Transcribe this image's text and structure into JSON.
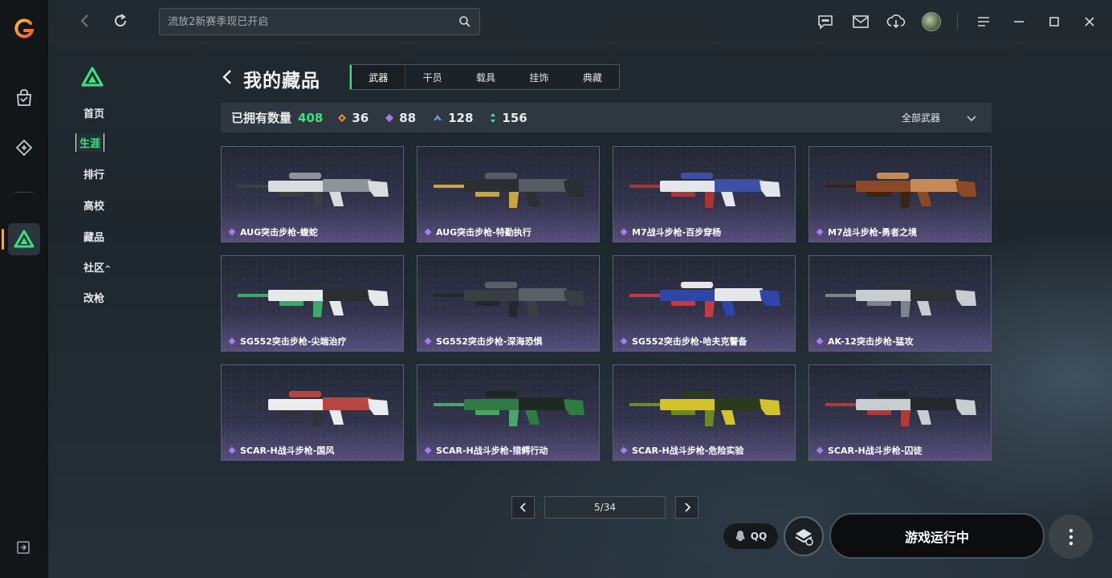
{
  "search": {
    "placeholder": "流放2新赛季现已开启"
  },
  "sidebar": {
    "items": [
      {
        "label": "首页",
        "active": false
      },
      {
        "label": "生涯",
        "active": true
      },
      {
        "label": "排行",
        "active": false
      },
      {
        "label": "高校",
        "active": false
      },
      {
        "label": "藏品",
        "active": false
      },
      {
        "label": "社区",
        "suffix": "^",
        "active": false
      },
      {
        "label": "改枪",
        "active": false
      }
    ]
  },
  "page": {
    "title": "我的藏品"
  },
  "tabs": [
    {
      "label": "武器",
      "active": true
    },
    {
      "label": "干员",
      "active": false
    },
    {
      "label": "载具",
      "active": false
    },
    {
      "label": "挂饰",
      "active": false
    },
    {
      "label": "典藏",
      "active": false
    }
  ],
  "stats": {
    "owned_label": "已拥有数量",
    "owned_total": "408",
    "tiers": [
      {
        "icon": "orange-diamond-icon",
        "color": "#e8893a",
        "count": "36"
      },
      {
        "icon": "purple-diamond-icon",
        "color": "#a77bf0",
        "count": "88"
      },
      {
        "icon": "blue-wing-icon",
        "color": "#5aa7e0",
        "count": "128"
      },
      {
        "icon": "green-arrows-icon",
        "color": "#3ee0a8",
        "count": "156"
      }
    ],
    "filter_label": "全部武器"
  },
  "items": [
    {
      "name": "AUG突击步枪-蝮蛇",
      "palette": [
        "#d9dcdf",
        "#8e9399",
        "#3b3f44"
      ]
    },
    {
      "name": "AUG突击步枪-特勤执行",
      "palette": [
        "#2b2e32",
        "#575c62",
        "#c9a643"
      ]
    },
    {
      "name": "M7战斗步枪-百步穿杨",
      "palette": [
        "#e3e6ea",
        "#3e4fa8",
        "#a83636"
      ]
    },
    {
      "name": "M7战斗步枪-勇者之境",
      "palette": [
        "#8a4a2a",
        "#c48a57",
        "#3a2418"
      ]
    },
    {
      "name": "SG552突击步枪-尖端治疗",
      "palette": [
        "#e6e8ea",
        "#2b2e32",
        "#3ea86a"
      ]
    },
    {
      "name": "SG552突击步枪-深海恐惧",
      "palette": [
        "#3a3e43",
        "#5b6067",
        "#24272b"
      ]
    },
    {
      "name": "SG552突击步枪-哈夫克警备",
      "palette": [
        "#2f45a8",
        "#e4e6ea",
        "#c23a44"
      ]
    },
    {
      "name": "AK-12突击步枪-猛攻",
      "palette": [
        "#c9ccd0",
        "#2e3135",
        "#7e848b"
      ]
    },
    {
      "name": "SCAR-H战斗步枪-国风",
      "palette": [
        "#e9ebed",
        "#b84640",
        "#2f3237"
      ]
    },
    {
      "name": "SCAR-H战斗步枪-猎鳄行动",
      "palette": [
        "#2f7a45",
        "#1d2a22",
        "#4fa36a"
      ]
    },
    {
      "name": "SCAR-H战斗步枪-危险实验",
      "palette": [
        "#d4c12e",
        "#2a3a1a",
        "#6a8a2a"
      ]
    },
    {
      "name": "SCAR-H战斗步枪-囚徒",
      "palette": [
        "#c9ccd0",
        "#25282c",
        "#b03a3a"
      ]
    }
  ],
  "pagination": {
    "label": "5/34"
  },
  "bottom": {
    "qq_label": "QQ",
    "run_label": "游戏运行中"
  }
}
